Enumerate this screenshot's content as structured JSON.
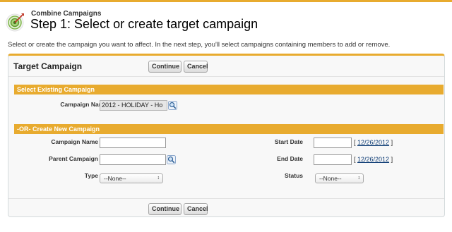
{
  "header": {
    "pre_title": "Combine Campaigns",
    "title": "Step 1: Select or create target campaign",
    "instructions": "Select or create the campaign you want to affect. In the next step, you'll select campaigns containing members to add or remove."
  },
  "panel": {
    "title": "Target Campaign",
    "continue_label": "Continue",
    "cancel_label": "Cancel"
  },
  "existing": {
    "section_title": "Select Existing Campaign",
    "campaign_name_label": "Campaign Name",
    "campaign_name_value": "2012 - HOLIDAY - Ho"
  },
  "create": {
    "section_title": "-OR- Create New Campaign",
    "campaign_name_label": "Campaign Name",
    "parent_campaign_label": "Parent Campaign",
    "type_label": "Type",
    "type_value": "--None--",
    "start_date_label": "Start Date",
    "start_date_link": "12/26/2012",
    "end_date_label": "End Date",
    "end_date_link": "12/26/2012",
    "status_label": "Status",
    "status_value": "--None--"
  },
  "colors": {
    "accent": "#e8ab2f",
    "link": "#0b3a73"
  },
  "icons": [
    "campaign-target-icon",
    "lookup-magnifier-icon",
    "dropdown-arrow-icon"
  ]
}
